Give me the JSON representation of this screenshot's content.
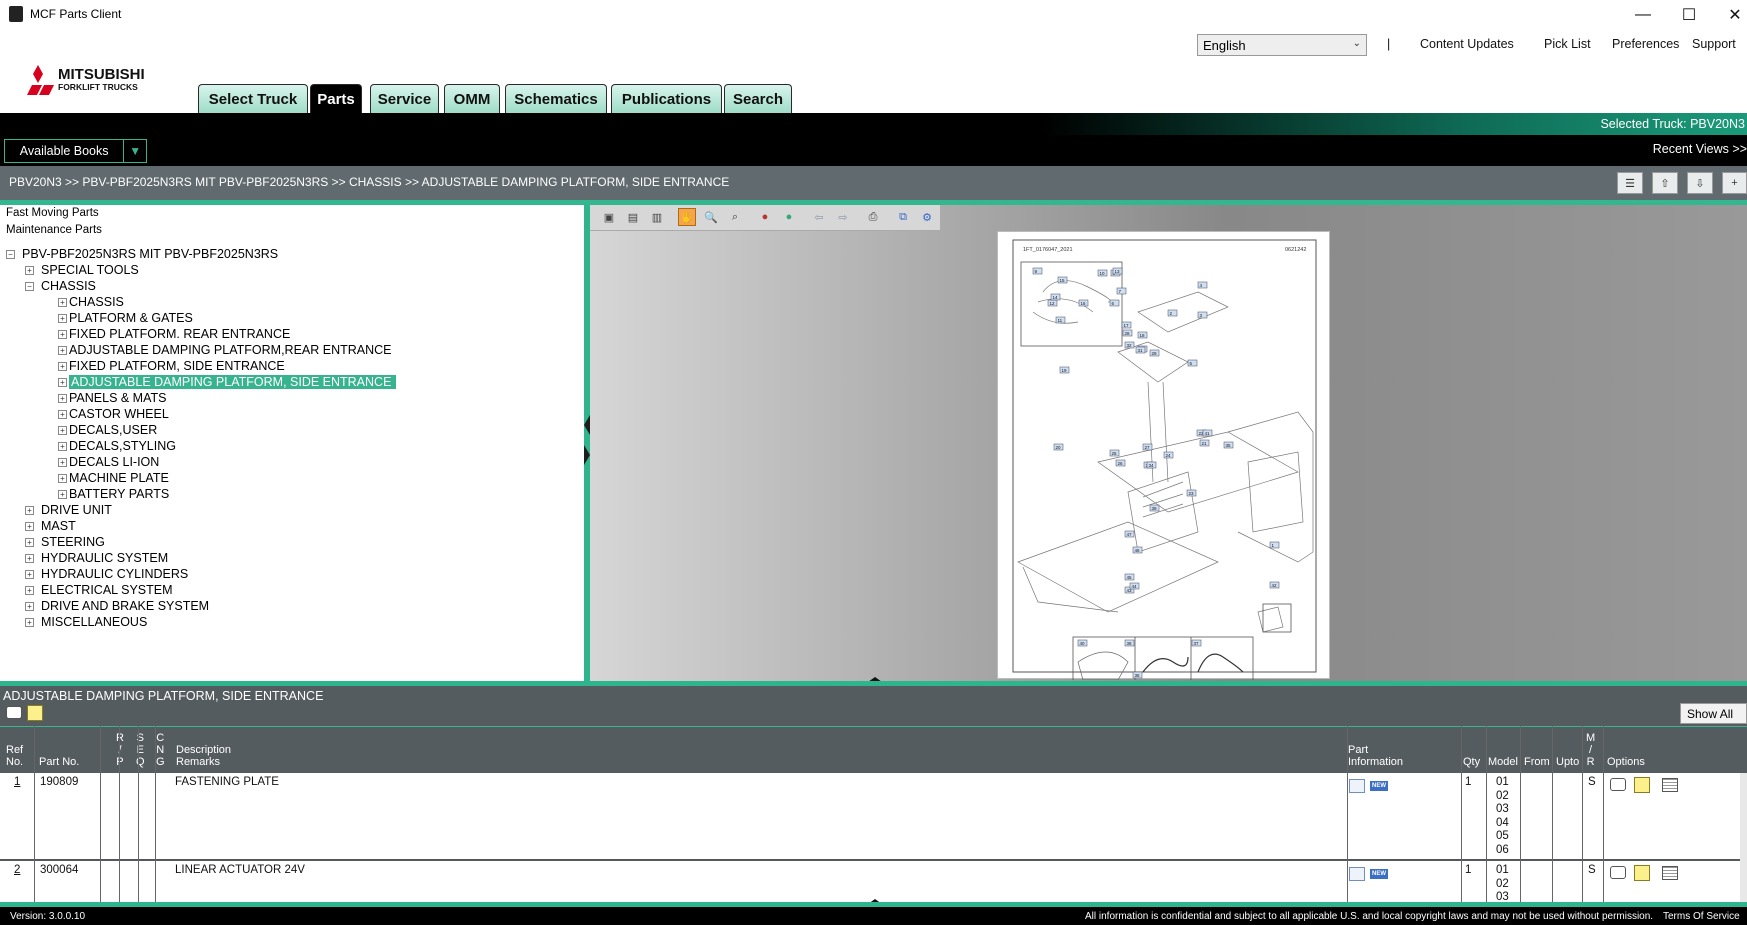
{
  "window": {
    "title": "MCF Parts Client",
    "minimize": "—",
    "maximize": "☐",
    "close": "✕"
  },
  "header": {
    "language": "English",
    "separator": "|",
    "links": [
      "Content Updates",
      "Pick List",
      "Preferences",
      "Support"
    ]
  },
  "tabs": [
    "Select Truck",
    "Parts",
    "Service",
    "OMM",
    "Schematics",
    "Publications",
    "Search"
  ],
  "active_tab": "Parts",
  "selected_truck": "Selected Truck:  PBV20N3",
  "available_books": "Available Books",
  "recent_views": "Recent Views >>",
  "breadcrumb": "PBV20N3 >> PBV-PBF2025N3RS MIT PBV-PBF2025N3RS >> CHASSIS >> ADJUSTABLE DAMPING PLATFORM, SIDE ENTRANCE",
  "tree": {
    "quick_links": [
      "Fast Moving Parts",
      "Maintenance Parts"
    ],
    "root": "PBV-PBF2025N3RS MIT PBV-PBF2025N3RS",
    "level1_before": [
      "SPECIAL TOOLS"
    ],
    "chassis": "CHASSIS",
    "chassis_children": [
      "CHASSIS",
      "PLATFORM & GATES",
      "FIXED PLATFORM. REAR ENTRANCE",
      "ADJUSTABLE DAMPING PLATFORM,REAR ENTRANCE",
      "FIXED PLATFORM, SIDE ENTRANCE",
      "ADJUSTABLE DAMPING PLATFORM, SIDE ENTRANCE",
      "PANELS & MATS",
      "CASTOR WHEEL",
      "DECALS,USER",
      "DECALS,STYLING",
      "DECALS LI-ION",
      "MACHINE PLATE",
      "BATTERY PARTS"
    ],
    "selected_child": "ADJUSTABLE DAMPING PLATFORM, SIDE ENTRANCE",
    "level1_after": [
      "DRIVE UNIT",
      "MAST",
      "STEERING",
      "HYDRAULIC SYSTEM",
      "HYDRAULIC CYLINDERS",
      "ELECTRICAL SYSTEM",
      "DRIVE AND BRAKE SYSTEM",
      "MISCELLANEOUS"
    ]
  },
  "drawing": {
    "code_left": "1FT_0176047_2021",
    "code_right": "0621242",
    "callouts": [
      "1",
      "2",
      "3",
      "4",
      "5",
      "6",
      "7",
      "8",
      "9",
      "10",
      "11",
      "12",
      "13",
      "14",
      "15",
      "16",
      "17",
      "18",
      "19",
      "20",
      "21",
      "22",
      "23",
      "24",
      "25",
      "26",
      "27",
      "28",
      "29",
      "30",
      "31",
      "32",
      "33",
      "34",
      "35",
      "36",
      "37",
      "38",
      "39",
      "40",
      "41",
      "42",
      "43",
      "44",
      "45",
      "46",
      "47"
    ]
  },
  "parts": {
    "title": "ADJUSTABLE DAMPING PLATFORM, SIDE ENTRANCE",
    "show_all": "Show All",
    "headers": {
      "ref": [
        "Ref",
        "No."
      ],
      "part_no": "Part No.",
      "rp": [
        "R",
        "/",
        "P"
      ],
      "seq": [
        "S",
        "E",
        "Q"
      ],
      "cng": [
        "C",
        "N",
        "G"
      ],
      "desc": [
        "Description",
        "Remarks"
      ],
      "info": [
        "Part",
        "Information"
      ],
      "qty": "Qty",
      "model": "Model",
      "from": "From",
      "upto": "Upto",
      "mr": [
        "M",
        "/",
        "R"
      ],
      "options": "Options"
    },
    "rows": [
      {
        "ref": "1",
        "part_no": "190809",
        "desc": "FASTENING PLATE",
        "qty": "1",
        "models": [
          "01",
          "02",
          "03",
          "04",
          "05",
          "06"
        ],
        "mr": "S"
      },
      {
        "ref": "2",
        "part_no": "300064",
        "desc": "LINEAR ACTUATOR 24V",
        "qty": "1",
        "models": [
          "01",
          "02",
          "03"
        ],
        "mr": "S"
      }
    ],
    "new_badge": "NEW"
  },
  "footer": {
    "version": "Version: 3.0.0.10",
    "notice": "All information is confidential and subject to all applicable U.S. and local copyright laws and may not be used without permission.",
    "terms": "Terms Of Service"
  },
  "colors": {
    "accent": "#32b78f",
    "header_bg": "#000000",
    "bar_bg": "#616a6f",
    "brand_red": "#d7001f"
  }
}
